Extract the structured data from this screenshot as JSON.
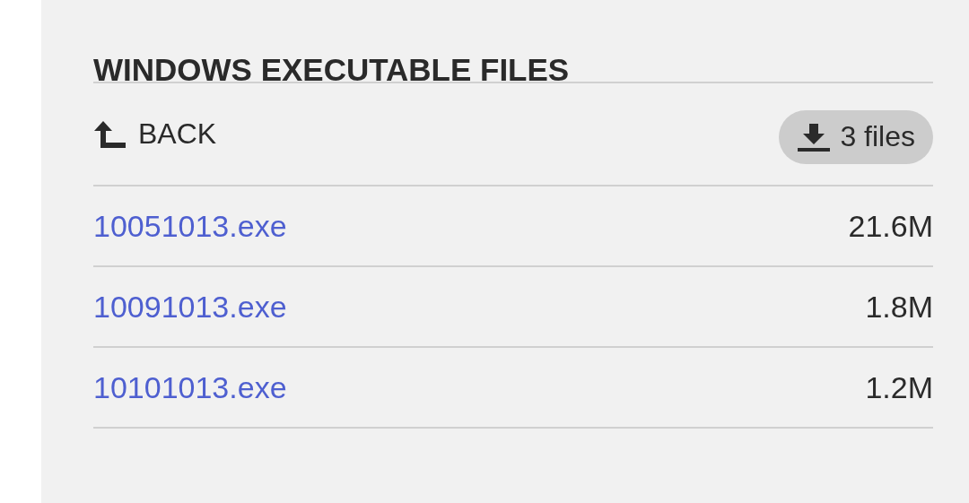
{
  "title": "WINDOWS EXECUTABLE FILES",
  "back": {
    "label": "BACK"
  },
  "download": {
    "label": "3 files"
  },
  "files": [
    {
      "name": "10051013.exe",
      "size": "21.6M"
    },
    {
      "name": "10091013.exe",
      "size": "1.8M"
    },
    {
      "name": "10101013.exe",
      "size": "1.2M"
    }
  ]
}
